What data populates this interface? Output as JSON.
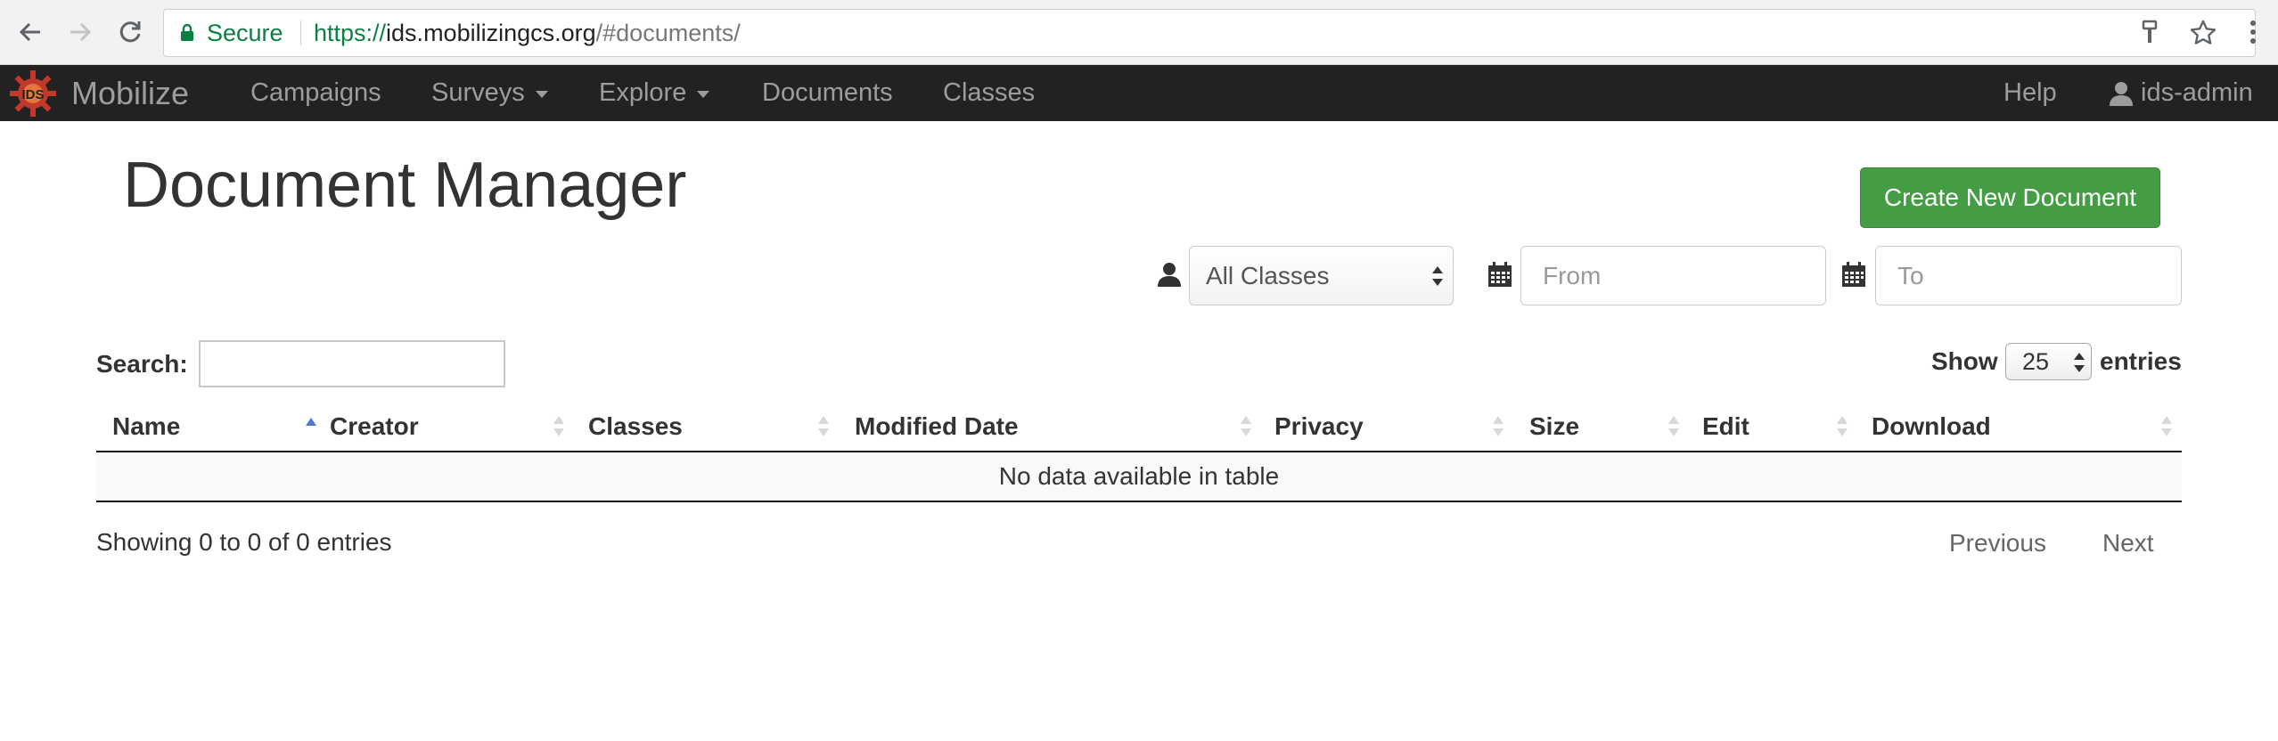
{
  "browser": {
    "secure_label": "Secure",
    "url_scheme": "https://",
    "url_host": "ids.mobilizingcs.org",
    "url_path": "/#documents/"
  },
  "navbar": {
    "brand_name": "Mobilize",
    "logo_text": "IDS",
    "items": [
      {
        "label": "Campaigns"
      },
      {
        "label": "Surveys"
      },
      {
        "label": "Explore"
      },
      {
        "label": "Documents"
      },
      {
        "label": "Classes"
      }
    ],
    "help_label": "Help",
    "user_label": "ids-admin"
  },
  "page": {
    "title": "Document Manager",
    "create_button": "Create New Document"
  },
  "filters": {
    "class_select": "All Classes",
    "from_placeholder": "From",
    "to_placeholder": "To"
  },
  "table_controls": {
    "search_label": "Search:",
    "show_label": "Show",
    "page_size": "25",
    "entries_label": "entries"
  },
  "table": {
    "columns": [
      "Name",
      "Creator",
      "Classes",
      "Modified Date",
      "Privacy",
      "Size",
      "Edit",
      "Download"
    ],
    "empty_message": "No data available in table"
  },
  "footer": {
    "info": "Showing 0 to 0 of 0 entries",
    "previous": "Previous",
    "next": "Next"
  },
  "colors": {
    "navbar_bg": "#222222",
    "primary_button": "#449d44",
    "secure_green": "#0b8043",
    "sort_active": "#4a7ad8"
  }
}
